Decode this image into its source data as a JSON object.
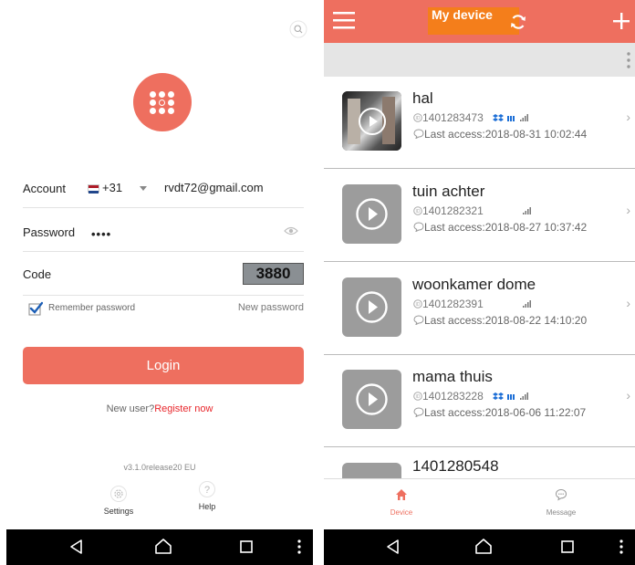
{
  "login": {
    "account_label": "Account",
    "country_code": "+31",
    "account_value": "rvdt72@gmail.com",
    "password_label": "Password",
    "password_value": "••••",
    "code_label": "Code",
    "captcha": "3880",
    "remember_label": "Remember password",
    "new_password": "New password",
    "login_button": "Login",
    "new_user": "New user?",
    "register": "Register now",
    "version": "v3.1.0release20 EU",
    "settings_label": "Settings",
    "help_label": "Help",
    "colors": {
      "accent": "#ee6f5f",
      "register": "#e8262b"
    },
    "icons": [
      "search-icon",
      "app-logo-icon",
      "netherlands-flag-icon",
      "eye-icon",
      "checkbox-icon",
      "settings-icon",
      "help-icon"
    ]
  },
  "devices": {
    "title": "My device",
    "items": [
      {
        "name": "hal",
        "id": "1401283473",
        "access": "Last access:2018-08-31 10:02:44"
      },
      {
        "name": "tuin achter",
        "id": "1401282321",
        "access": "Last access:2018-08-27 10:37:42"
      },
      {
        "name": "woonkamer dome",
        "id": "1401282391",
        "access": "Last access:2018-08-22 14:10:20"
      },
      {
        "name": "mama thuis",
        "id": "1401283228",
        "access": "Last access:2018-06-06 11:22:07"
      },
      {
        "name": "1401280548",
        "id": "",
        "access": ""
      }
    ],
    "tabs": [
      {
        "label": "Device",
        "active": true
      },
      {
        "label": "Message",
        "active": false
      }
    ],
    "colors": {
      "header": "#ee6f5f",
      "title_highlight": "#f47e1b"
    },
    "icons": [
      "menu-icon",
      "refresh-icon",
      "add-icon",
      "more-vertical-icon",
      "play-icon",
      "id-icon",
      "wifi-signal-icon",
      "comment-icon",
      "chevron-right-icon",
      "home-icon",
      "message-icon"
    ]
  },
  "system_nav": {
    "icons": [
      "back-icon",
      "home-nav-icon",
      "recents-icon",
      "overflow-icon"
    ]
  }
}
